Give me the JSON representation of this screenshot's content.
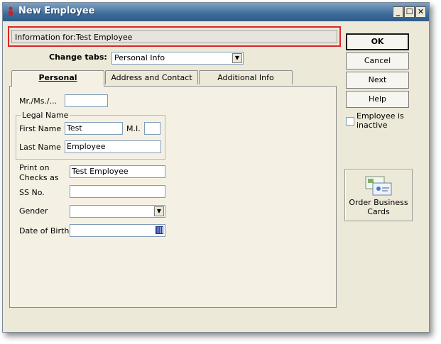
{
  "window": {
    "title": "New Employee"
  },
  "controls": {
    "minimize": "_",
    "maximize": "☐",
    "close": "✕"
  },
  "info": {
    "label": "Information for:",
    "name": "Test Employee"
  },
  "change_tabs": {
    "label": "Change tabs:",
    "selected": "Personal Info"
  },
  "tabs": [
    {
      "label": "Personal",
      "active": true
    },
    {
      "label": "Address and Contact",
      "active": false
    },
    {
      "label": "Additional Info",
      "active": false
    }
  ],
  "form": {
    "salutation_label": "Mr./Ms./...",
    "salutation_value": "",
    "legal_name_group": "Legal Name",
    "first_name_label": "First Name",
    "first_name_value": "Test",
    "mi_label": "M.I.",
    "mi_value": "",
    "last_name_label": "Last Name",
    "last_name_value": "Employee",
    "print_checks_label_1": "Print on",
    "print_checks_label_2": "Checks as",
    "print_checks_value": "Test Employee",
    "ss_label": "SS No.",
    "ss_value": "",
    "gender_label": "Gender",
    "gender_value": "",
    "dob_label": "Date of Birth",
    "dob_value": ""
  },
  "buttons": {
    "ok": "OK",
    "cancel": "Cancel",
    "next": "Next",
    "help": "Help"
  },
  "inactive": {
    "label_1": "Employee is",
    "label_2": "inactive",
    "checked": false
  },
  "order_cards": {
    "label_1": "Order Business",
    "label_2": "Cards",
    "icon": "business-cards-icon"
  },
  "colors": {
    "title_bar": "#3d6b98",
    "highlight_border": "#d8262c",
    "calendar_icon": "#2b45a8"
  }
}
